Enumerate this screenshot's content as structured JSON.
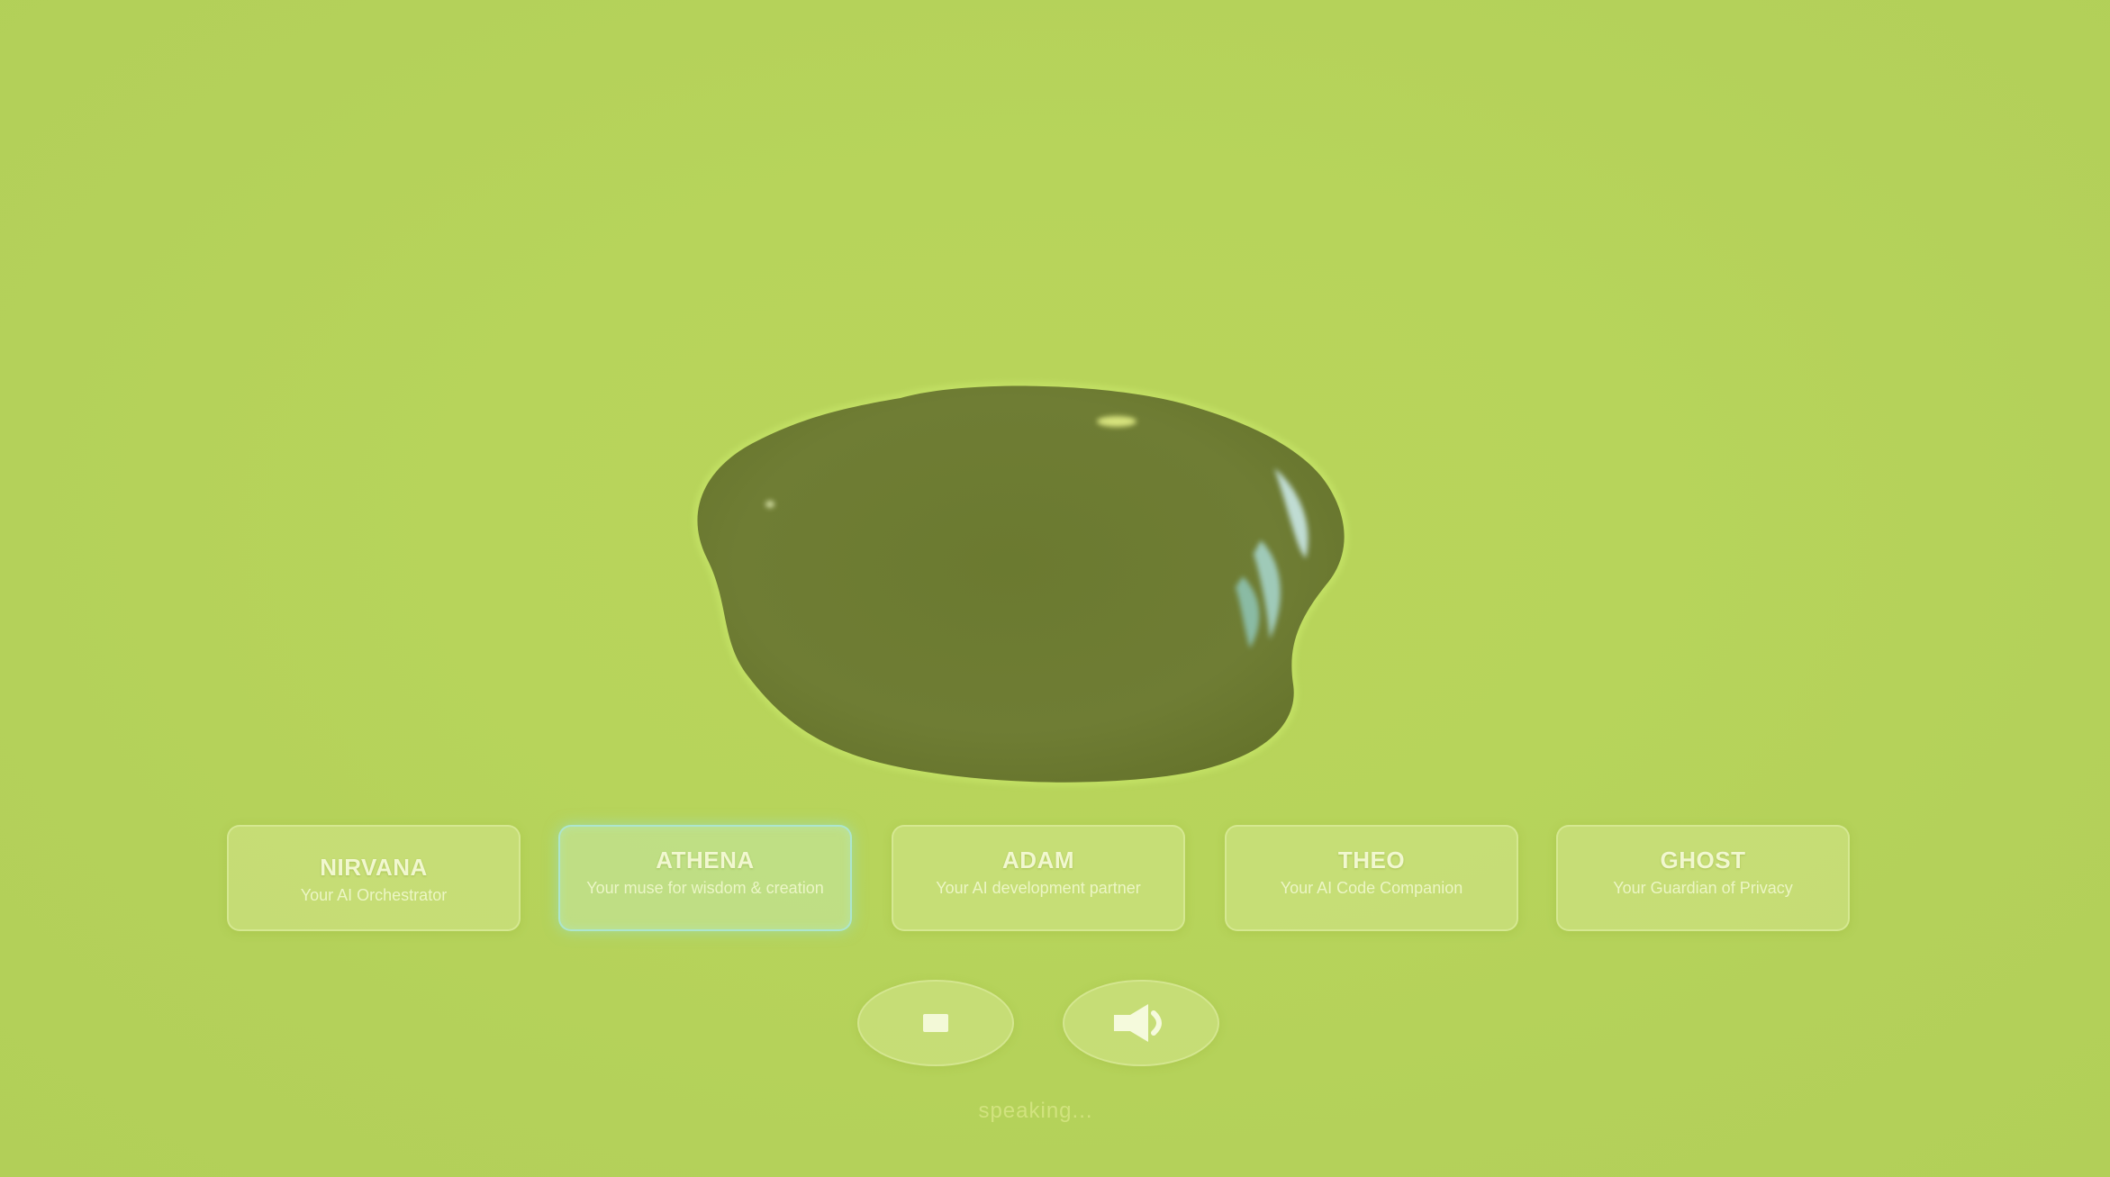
{
  "theme": {
    "background": "#b8d45a",
    "blob_color": "#6f7d34",
    "active_border": "#aae6dc"
  },
  "agents": [
    {
      "name": "NIRVANA",
      "description": "Your AI Orchestrator",
      "active": false
    },
    {
      "name": "ATHENA",
      "description": "Your muse for wisdom & creation",
      "active": true
    },
    {
      "name": "ADAM",
      "description": "Your AI development partner",
      "active": false
    },
    {
      "name": "THEO",
      "description": "Your AI Code Companion",
      "active": false
    },
    {
      "name": "GHOST",
      "description": "Your Guardian of Privacy",
      "active": false
    }
  ],
  "controls": {
    "stop_icon": "stop-icon",
    "speaker_icon": "speaker-icon"
  },
  "status": {
    "text": "speaking..."
  }
}
